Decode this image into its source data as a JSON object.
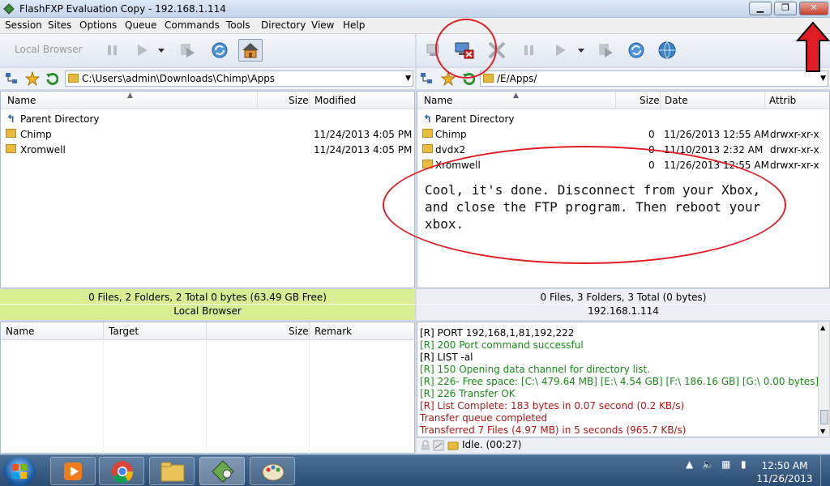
{
  "window": {
    "title": "FlashFXP Evaluation Copy - 192.168.1.114"
  },
  "menu": [
    "Session",
    "Sites",
    "Options",
    "Queue",
    "Commands",
    "Tools",
    "Directory",
    "View",
    "Help"
  ],
  "local": {
    "toolbar_label": "Local Browser",
    "path": "C:\\Users\\admin\\Downloads\\Chimp\\Apps",
    "columns": {
      "name": "Name",
      "size": "Size",
      "modified": "Modified"
    },
    "rows": [
      {
        "name": "Parent Directory",
        "size": "",
        "modified": ""
      },
      {
        "name": "Chimp",
        "size": "",
        "modified": "11/24/2013 4:05 PM"
      },
      {
        "name": "Xromwell",
        "size": "",
        "modified": "11/24/2013 4:05 PM"
      }
    ],
    "status_line1": "0 Files, 2 Folders, 2 Total 0 bytes (63.49 GB Free)",
    "status_line2": "Local Browser"
  },
  "remote": {
    "path": "/E/Apps/",
    "columns": {
      "name": "Name",
      "size": "Size",
      "date": "Date",
      "attrib": "Attrib"
    },
    "rows": [
      {
        "name": "Parent Directory",
        "size": "",
        "date": "",
        "attrib": ""
      },
      {
        "name": "Chimp",
        "size": "0",
        "date": "11/26/2013 12:55 AM",
        "attrib": "drwxr-xr-x"
      },
      {
        "name": "dvdx2",
        "size": "0",
        "date": "11/10/2013 2:32 AM",
        "attrib": "drwxr-xr-x"
      },
      {
        "name": "Xromwell",
        "size": "0",
        "date": "11/26/2013 12:55 AM",
        "attrib": "drwxr-xr-x"
      }
    ],
    "status_line1": "0 Files, 3 Folders, 3 Total (0 bytes)",
    "status_line2": "192.168.1.114"
  },
  "queue": {
    "columns": {
      "name": "Name",
      "target": "Target",
      "size": "Size",
      "remark": "Remark"
    }
  },
  "log": [
    {
      "text": "[R] PORT 192,168,1,81,192,222",
      "color": "#000000"
    },
    {
      "text": "[R] 200 Port command successful",
      "color": "#1a8a1a"
    },
    {
      "text": "[R] LIST -al",
      "color": "#000000"
    },
    {
      "text": "[R] 150 Opening data channel for directory list.",
      "color": "#1a8a1a"
    },
    {
      "text": "[R] 226- Free space: [C:\\ 479.64 MB] [E:\\ 4.54 GB] [F:\\ 186.16 GB] [G:\\ 0.00 bytes]",
      "color": "#1a8a1a"
    },
    {
      "text": "[R] 226 Transfer OK",
      "color": "#1a8a1a"
    },
    {
      "text": "[R] List Complete: 183 bytes in 0.07 second (0.2 KB/s)",
      "color": "#b01818"
    },
    {
      "text": "Transfer queue completed",
      "color": "#b01818"
    },
    {
      "text": "Transferred 7 Files (4.97 MB) in 5 seconds (965.7 KB/s)",
      "color": "#b01818"
    }
  ],
  "idle_status": "Idle. (00:27)",
  "annotation": {
    "text": "Cool, it's done.  Disconnect from your Xbox, and close the FTP program.  Then reboot your xbox."
  },
  "taskbar": {
    "time": "12:50 AM",
    "date": "11/26/2013"
  },
  "colors": {
    "accent_red": "#e01c24",
    "local_status_bg": "#d9ed92"
  }
}
